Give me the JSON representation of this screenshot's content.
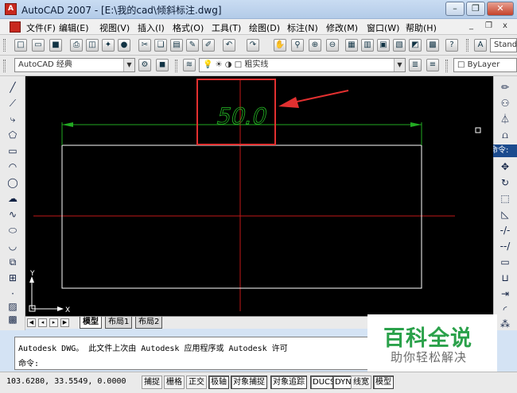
{
  "window": {
    "title": "AutoCAD 2007 - [E:\\我的cad\\倾斜标注.dwg]",
    "minimize_glyph": "–",
    "restore_glyph": "❐",
    "close_glyph": "✕"
  },
  "menu": {
    "items": [
      "文件(F)",
      "编辑(E)",
      "视图(V)",
      "插入(I)",
      "格式(O)",
      "工具(T)",
      "绘图(D)",
      "标注(N)",
      "修改(M)",
      "窗口(W)",
      "帮助(H)"
    ],
    "mdi_minimize": "_",
    "mdi_restore": "❐",
    "mdi_close": "x"
  },
  "toolbar_standard": {
    "text_style": "Stand"
  },
  "toolbar_layers": {
    "workspace": "AutoCAD 经典",
    "layer": "粗实线",
    "color": "ByLayer"
  },
  "drawing": {
    "dimension_text": "50.0",
    "axis_x": "X",
    "axis_y": "Y",
    "colors": {
      "background": "#000000",
      "dimension": "#22aa22",
      "centerline": "#c21818",
      "highlight": "#e23030",
      "outline": "#ffffff"
    }
  },
  "side_panel": {
    "command_tag": "命令:"
  },
  "layout_tabs": {
    "tabs": [
      "模型",
      "布局1",
      "布局2"
    ],
    "active": "模型"
  },
  "command_window": {
    "line1": "Autodesk DWG。  此文件上次由 Autodesk 应用程序或 Autodesk 许可",
    "prompt": "命令:"
  },
  "status": {
    "coords": "103.6280, 33.5549, 0.0000",
    "buttons": [
      "捕捉",
      "栅格",
      "正交",
      "极轴",
      "对象捕捉",
      "对象追踪",
      "DUCS",
      "DYN",
      "线宽",
      "模型"
    ]
  },
  "watermark": {
    "logo": "百科全说",
    "subtitle": "助你轻松解决"
  }
}
